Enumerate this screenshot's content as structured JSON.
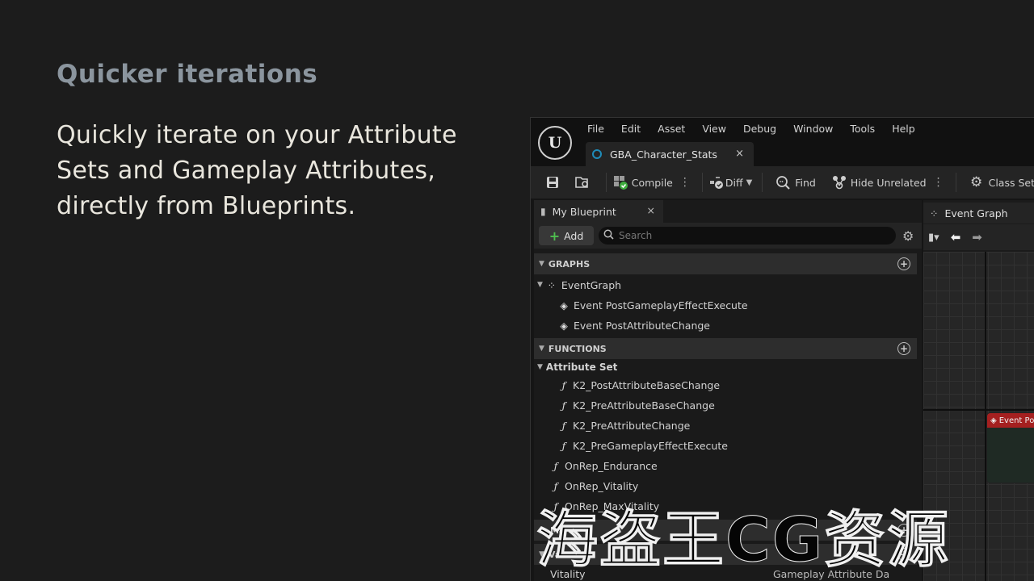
{
  "slide": {
    "heading": "Quicker iterations",
    "body_lines": [
      "Quickly iterate on your Attribute",
      "Sets and Gameplay Attributes,",
      "directly from Blueprints."
    ]
  },
  "editor": {
    "menu": [
      "File",
      "Edit",
      "Asset",
      "View",
      "Debug",
      "Window",
      "Tools",
      "Help"
    ],
    "doc_tab": {
      "label": "GBA_Character_Stats",
      "close": "×"
    },
    "toolbar": {
      "compile": "Compile",
      "diff": "Diff",
      "find": "Find",
      "hide_unrelated": "Hide Unrelated",
      "class_settings": "Class Set"
    },
    "my_blueprint": {
      "tab_label": "My Blueprint",
      "tab_close": "×",
      "add_label": "Add",
      "search_placeholder": "Search",
      "sections": {
        "graphs": "GRAPHS",
        "functions": "FUNCTIONS",
        "macros": "Ma",
        "variables": "Va"
      },
      "graphs_items": [
        "EventGraph",
        "Event PostGameplayEffectExecute",
        "Event PostAttributeChange"
      ],
      "functions_category": "Attribute Set",
      "function_items": [
        "K2_PostAttributeBaseChange",
        "K2_PreAttributeBaseChange",
        "K2_PreAttributeChange",
        "K2_PreGameplayEffectExecute"
      ],
      "onrep_items": [
        "OnRep_Endurance",
        "OnRep_Vitality",
        "OnRep_MaxVitality"
      ],
      "variable_row": {
        "name": "Vitality",
        "type": "Gameplay Attribute Da"
      }
    },
    "event_graph": {
      "tab_label": "Event Graph",
      "node_label": "Event Po"
    }
  },
  "watermark": "海盗王CG资源"
}
